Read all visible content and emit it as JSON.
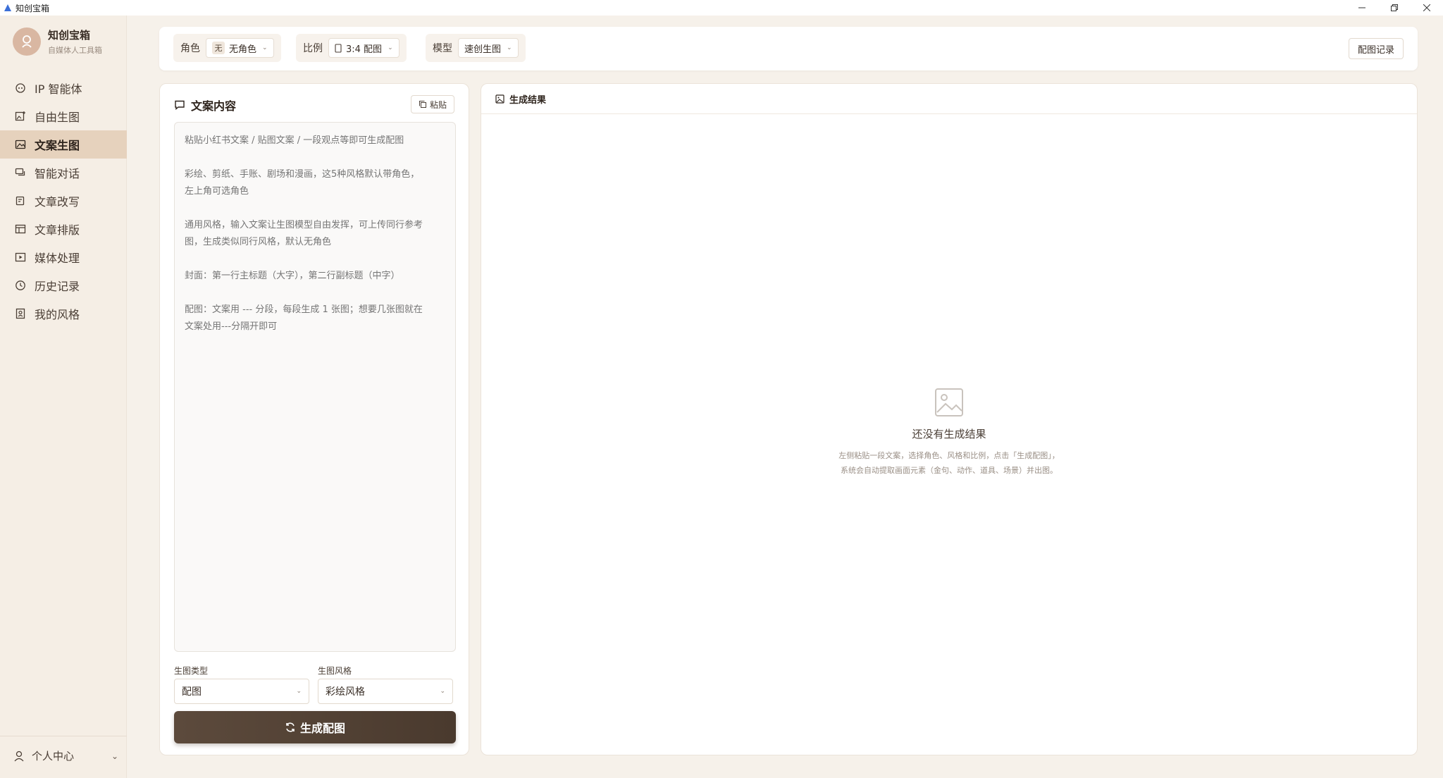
{
  "window": {
    "title": "知创宝箱"
  },
  "brand": {
    "name": "知创宝箱",
    "subtitle": "自媒体人工具箱"
  },
  "sidebar": {
    "items": [
      {
        "label": "IP 智能体",
        "icon": "robot-icon",
        "active": false
      },
      {
        "label": "自由生图",
        "icon": "image-plus-icon",
        "active": false
      },
      {
        "label": "文案生图",
        "icon": "image-icon",
        "active": true
      },
      {
        "label": "智能对话",
        "icon": "chat-icon",
        "active": false
      },
      {
        "label": "文章改写",
        "icon": "edit-doc-icon",
        "active": false
      },
      {
        "label": "文章排版",
        "icon": "layout-icon",
        "active": false
      },
      {
        "label": "媒体处理",
        "icon": "media-icon",
        "active": false
      },
      {
        "label": "历史记录",
        "icon": "clock-icon",
        "active": false
      },
      {
        "label": "我的风格",
        "icon": "style-icon",
        "active": false
      }
    ],
    "profile_label": "个人中心"
  },
  "toolbar": {
    "role_label": "角色",
    "role_badge": "无",
    "role_value": "无角色",
    "ratio_label": "比例",
    "ratio_value": "3:4 配图",
    "model_label": "模型",
    "model_value": "速创生图",
    "history_button": "配图记录"
  },
  "left_panel": {
    "title": "文案内容",
    "paste_button": "粘贴",
    "placeholder": "粘贴小红书文案 / 贴图文案 / 一段观点等即可生成配图\n\n彩绘、剪纸、手账、剧场和漫画，这5种风格默认带角色，\n左上角可选角色\n\n通用风格，输入文案让生图模型自由发挥，可上传同行参考\n图，生成类似同行风格，默认无角色\n\n封面：第一行主标题（大字），第二行副标题（中字）\n\n配图：文案用 --- 分段，每段生成 1 张图；想要几张图就在\n文案处用---分隔开即可",
    "type_label": "生图类型",
    "type_value": "配图",
    "style_label": "生图风格",
    "style_value": "彩绘风格",
    "generate_button": "生成配图"
  },
  "right_panel": {
    "title": "生成结果",
    "empty_title": "还没有生成结果",
    "empty_desc_line1": "左侧粘贴一段文案，选择角色、风格和比例，点击「生成配图」，",
    "empty_desc_line2": "系统会自动提取画面元素（金句、动作、道具、场景）并出图。"
  },
  "colors": {
    "accent_active": "#e6d2bd",
    "button_dark": "#5c4a3c",
    "background": "#f6f1ea"
  }
}
